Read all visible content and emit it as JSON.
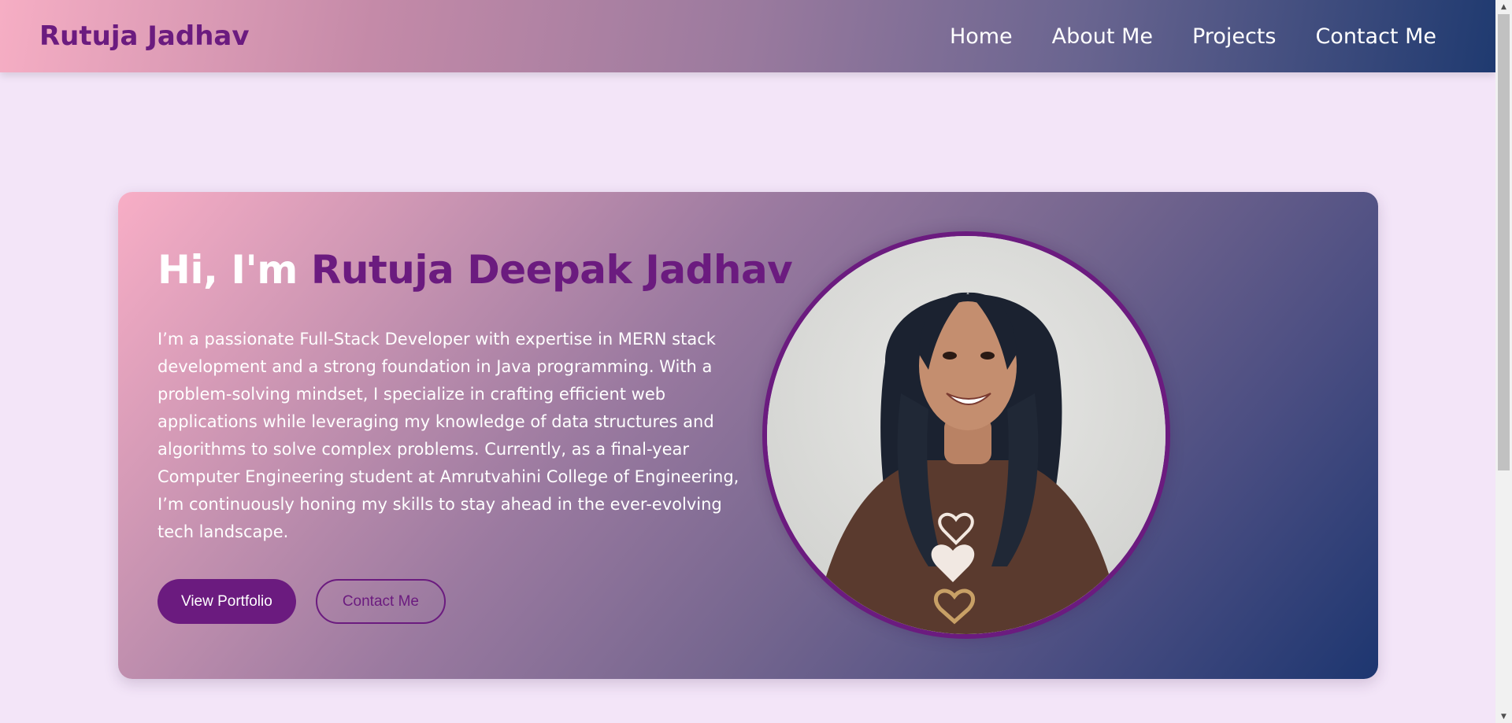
{
  "navbar": {
    "brand": "Rutuja Jadhav",
    "links": [
      {
        "label": "Home"
      },
      {
        "label": "About Me"
      },
      {
        "label": "Projects"
      },
      {
        "label": "Contact Me"
      }
    ]
  },
  "hero": {
    "greeting": "Hi, I'm ",
    "name": "Rutuja Deepak Jadhav",
    "description": "I’m a passionate Full-Stack Developer with expertise in MERN stack development and a strong foundation in Java programming. With a problem-solving mindset, I specialize in crafting efficient web applications while leveraging my knowledge of data structures and algorithms to solve complex problems. Currently, as a final-year Computer Engineering student at Amrutvahini College of Engineering, I’m continuously honing my skills to stay ahead in the ever-evolving tech landscape.",
    "primary_button": "View Portfolio",
    "secondary_button": "Contact Me"
  },
  "colors": {
    "accent": "#6b1b7f",
    "page_background": "#f3e5f8",
    "gradient_start": "#f8aec6",
    "gradient_end": "#1d3670"
  },
  "icons": {
    "scroll_up": "scroll-up-arrow-icon",
    "scroll_down": "scroll-down-arrow-icon"
  }
}
